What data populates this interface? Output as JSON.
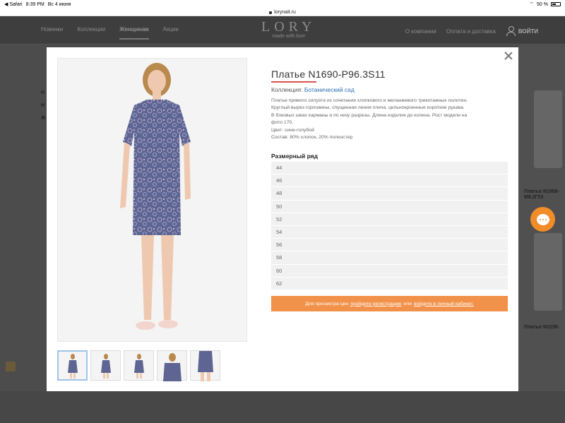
{
  "status_bar": {
    "back_app": "◀ Safari",
    "time": "8:39 PM",
    "date": "Вс 4 июня",
    "battery": "50 %"
  },
  "browser": {
    "url": "lorynait.ru"
  },
  "site": {
    "nav": [
      "Новинки",
      "Коллекции",
      "Женщинам",
      "Акции"
    ],
    "logo": "LORY",
    "logo_tagline": "made with love",
    "right_links": [
      "О компании",
      "Оплата и доставка"
    ],
    "login": "ВОЙТИ",
    "bg_captions": [
      "Платье N1908-\nМ8.2Г03",
      "Платье N1238-"
    ]
  },
  "product": {
    "title": "Платье N1690-Р96.3S11",
    "collection_label": "Коллекция:",
    "collection_value": "Ботанический сад",
    "description": [
      "Платье прямого силуэта из сочетания хлопкового и меланжевого трикотажных полотен.",
      "Круглый вырез горловины, спущенная линия плеча, цельнокроенные короткие рукава.",
      "В боковых швах карманы и по низу разрезы. Длина изделия до колена. Рост модели на",
      "фото 170.",
      "Цвет: сине-голубой",
      "Состав: 80% хлопок, 20% полиэстер"
    ],
    "sizes_title": "Размерный ряд",
    "sizes": [
      "44",
      "46",
      "48",
      "50",
      "52",
      "54",
      "56",
      "58",
      "60",
      "62"
    ],
    "cta_prefix": "Для просмотра цен",
    "cta_link1": "пройдите регистрацию",
    "cta_middle": "или",
    "cta_link2": "войдите в личный кабинет."
  },
  "colors": {
    "accent_orange": "#f2924a",
    "chat_orange": "#f28c28",
    "link_blue": "#2a6eb8",
    "title_underline": "#d9534f"
  }
}
